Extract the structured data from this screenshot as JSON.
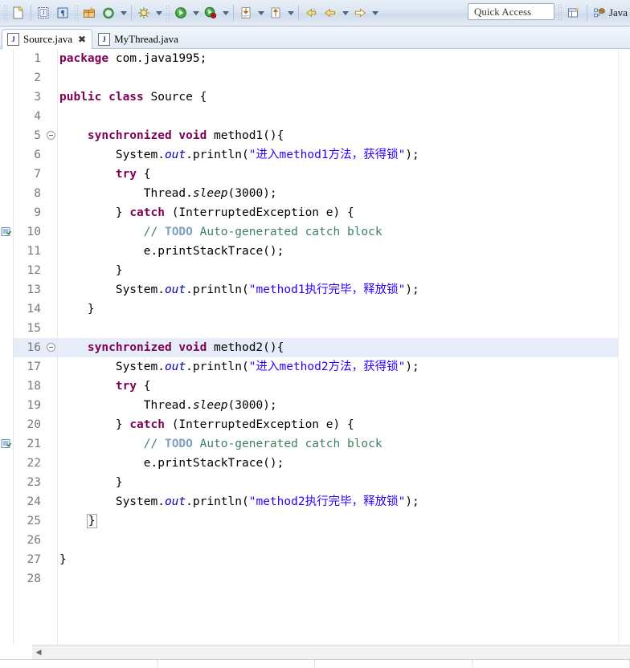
{
  "toolbar": {
    "icons": [
      {
        "name": "new-wizard-icon",
        "label": "New"
      },
      {
        "name": "new-java-class-icon",
        "label": "New Java Class"
      },
      {
        "name": "new-annotation-icon",
        "label": "New Annotation"
      },
      {
        "name": "new-package-icon",
        "label": "New Package"
      },
      {
        "name": "refresh-icon",
        "label": "Refresh"
      },
      {
        "name": "debug-icon",
        "label": "Debug"
      },
      {
        "name": "run-icon",
        "label": "Run"
      },
      {
        "name": "coverage-icon",
        "label": "Coverage"
      },
      {
        "name": "external-tools-icon",
        "label": "External Tools"
      },
      {
        "name": "open-type-icon",
        "label": "Open Type"
      },
      {
        "name": "back-icon",
        "label": "Back"
      },
      {
        "name": "previous-edit-icon",
        "label": "Previous Edit Location"
      },
      {
        "name": "forward-icon",
        "label": "Forward"
      }
    ],
    "quick_access_placeholder": "Quick Access",
    "open_perspective_icon": "open-perspective-icon",
    "perspective_label": "Java",
    "perspective_icon": "java-perspective-icon"
  },
  "tabs": [
    {
      "label": "Source.java",
      "icon": "java-file-icon",
      "active": true,
      "close": "✖"
    },
    {
      "label": "MyThread.java",
      "icon": "java-file-icon",
      "active": false,
      "close": ""
    }
  ],
  "editor": {
    "current_line": 16,
    "fold_lines": [
      5,
      16
    ],
    "task_marker_lines": [
      10,
      21
    ],
    "colors": {
      "keyword": "#7f0055",
      "string": "#2a00ff",
      "comment": "#3f7f5f",
      "todo_tag": "#7f9fbf",
      "static_field": "#0000c0",
      "current_line_bg": "#e6edf8",
      "line_number": "#787878"
    },
    "lines": [
      {
        "n": "1",
        "indent": 0,
        "tokens": [
          {
            "t": "package",
            "c": "kw"
          },
          {
            "t": " com.java1995;",
            "c": ""
          }
        ]
      },
      {
        "n": "2",
        "indent": 0,
        "tokens": []
      },
      {
        "n": "3",
        "indent": 0,
        "tokens": [
          {
            "t": "public class",
            "c": "kw"
          },
          {
            "t": " Source {",
            "c": ""
          }
        ]
      },
      {
        "n": "4",
        "indent": 0,
        "tokens": []
      },
      {
        "n": "5",
        "indent": 1,
        "tokens": [
          {
            "t": "synchronized void",
            "c": "kw"
          },
          {
            "t": " method1(){",
            "c": ""
          }
        ]
      },
      {
        "n": "6",
        "indent": 2,
        "tokens": [
          {
            "t": "System.",
            "c": ""
          },
          {
            "t": "out",
            "c": "fld"
          },
          {
            "t": ".println(",
            "c": ""
          },
          {
            "t": "\"进入method1方法，获得锁\"",
            "c": "str"
          },
          {
            "t": ");",
            "c": ""
          }
        ]
      },
      {
        "n": "7",
        "indent": 2,
        "tokens": [
          {
            "t": "try",
            "c": "kw"
          },
          {
            "t": " {",
            "c": ""
          }
        ]
      },
      {
        "n": "8",
        "indent": 3,
        "tokens": [
          {
            "t": "Thread.",
            "c": ""
          },
          {
            "t": "sleep",
            "c": "mth"
          },
          {
            "t": "(3000);",
            "c": ""
          }
        ]
      },
      {
        "n": "9",
        "indent": 2,
        "tokens": [
          {
            "t": "} ",
            "c": ""
          },
          {
            "t": "catch",
            "c": "kw"
          },
          {
            "t": " (InterruptedException e) {",
            "c": ""
          }
        ]
      },
      {
        "n": "10",
        "indent": 3,
        "tokens": [
          {
            "t": "// ",
            "c": "cmt"
          },
          {
            "t": "TODO",
            "c": "todo"
          },
          {
            "t": " Auto-generated catch block",
            "c": "cmt"
          }
        ]
      },
      {
        "n": "11",
        "indent": 3,
        "tokens": [
          {
            "t": "e.printStackTrace();",
            "c": ""
          }
        ]
      },
      {
        "n": "12",
        "indent": 2,
        "tokens": [
          {
            "t": "}",
            "c": ""
          }
        ]
      },
      {
        "n": "13",
        "indent": 2,
        "tokens": [
          {
            "t": "System.",
            "c": ""
          },
          {
            "t": "out",
            "c": "fld"
          },
          {
            "t": ".println(",
            "c": ""
          },
          {
            "t": "\"method1执行完毕，释放锁\"",
            "c": "str"
          },
          {
            "t": ");",
            "c": ""
          }
        ]
      },
      {
        "n": "14",
        "indent": 1,
        "tokens": [
          {
            "t": "}",
            "c": ""
          }
        ]
      },
      {
        "n": "15",
        "indent": 0,
        "tokens": []
      },
      {
        "n": "16",
        "indent": 1,
        "tokens": [
          {
            "t": "synchronized void",
            "c": "kw"
          },
          {
            "t": " method2(){",
            "c": ""
          }
        ]
      },
      {
        "n": "17",
        "indent": 2,
        "tokens": [
          {
            "t": "System.",
            "c": ""
          },
          {
            "t": "out",
            "c": "fld"
          },
          {
            "t": ".println(",
            "c": ""
          },
          {
            "t": "\"进入method2方法，获得锁\"",
            "c": "str"
          },
          {
            "t": ");",
            "c": ""
          }
        ]
      },
      {
        "n": "18",
        "indent": 2,
        "tokens": [
          {
            "t": "try",
            "c": "kw"
          },
          {
            "t": " {",
            "c": ""
          }
        ]
      },
      {
        "n": "19",
        "indent": 3,
        "tokens": [
          {
            "t": "Thread.",
            "c": ""
          },
          {
            "t": "sleep",
            "c": "mth"
          },
          {
            "t": "(3000);",
            "c": ""
          }
        ]
      },
      {
        "n": "20",
        "indent": 2,
        "tokens": [
          {
            "t": "} ",
            "c": ""
          },
          {
            "t": "catch",
            "c": "kw"
          },
          {
            "t": " (InterruptedException e) {",
            "c": ""
          }
        ]
      },
      {
        "n": "21",
        "indent": 3,
        "tokens": [
          {
            "t": "// ",
            "c": "cmt"
          },
          {
            "t": "TODO",
            "c": "todo"
          },
          {
            "t": " Auto-generated catch block",
            "c": "cmt"
          }
        ]
      },
      {
        "n": "22",
        "indent": 3,
        "tokens": [
          {
            "t": "e.printStackTrace();",
            "c": ""
          }
        ]
      },
      {
        "n": "23",
        "indent": 2,
        "tokens": [
          {
            "t": "}",
            "c": ""
          }
        ]
      },
      {
        "n": "24",
        "indent": 2,
        "tokens": [
          {
            "t": "System.",
            "c": ""
          },
          {
            "t": "out",
            "c": "fld"
          },
          {
            "t": ".println(",
            "c": ""
          },
          {
            "t": "\"method2执行完毕，释放锁\"",
            "c": "str"
          },
          {
            "t": ");",
            "c": ""
          }
        ]
      },
      {
        "n": "25",
        "indent": 1,
        "tokens": [
          {
            "t": "}",
            "c": "bracket-box"
          }
        ]
      },
      {
        "n": "26",
        "indent": 0,
        "tokens": []
      },
      {
        "n": "27",
        "indent": 0,
        "tokens": [
          {
            "t": "}",
            "c": ""
          }
        ]
      },
      {
        "n": "28",
        "indent": 0,
        "tokens": []
      }
    ]
  },
  "scrollbar": {
    "left_arrow": "◀"
  }
}
